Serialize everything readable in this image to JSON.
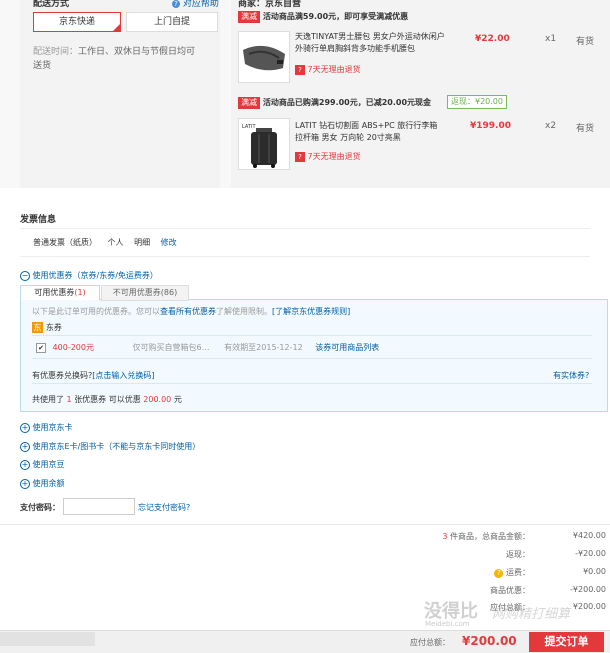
{
  "shipping": {
    "title": "配送方式",
    "help_link": "对应帮助",
    "opt_jd": "京东快递",
    "opt_self": "上门自提",
    "time_label": "配送时间：",
    "time_value": "工作日、双休日与节假日均可送货"
  },
  "store_header": "商家：京东自营",
  "promo1": {
    "tag": "满减",
    "text": "活动商品满59.00元，即可享受满减优惠"
  },
  "product1": {
    "name": "天逸TINYAT男士腰包 男女户外运动休闲户外骑行单肩胸斜背多功能手机腰包",
    "price": "¥22.00",
    "qty": "x1",
    "stock": "有货",
    "returns": "7天无理由退货"
  },
  "promo2": {
    "tag": "满减",
    "text": "活动商品已购满299.00元，已减20.00元现金",
    "saved": "返现：¥20.00"
  },
  "product2": {
    "name": "LATIT 钻石切割面 ABS+PC 旅行行李箱 拉杆箱 男女 万向轮 20寸亮黑",
    "price": "¥199.00",
    "qty": "x2",
    "stock": "有货",
    "returns": "7天无理由退货",
    "brand": "LATIT"
  },
  "invoice": {
    "title": "发票信息",
    "type": "普通发票（纸质）",
    "who": "个人",
    "detail": "明细",
    "edit": "修改"
  },
  "coupon": {
    "toggle": "使用优惠券（京券/东券/免运费券）",
    "tab_usable": "可用优惠券",
    "tab_usable_count": "(1)",
    "tab_unusable": "不可用优惠券(86)",
    "hint_prefix": "以下是此订单可用的优惠券。您可以",
    "hint_link": "查看所有优惠券",
    "hint_mid": "了解使用限制。",
    "hint_rule": "[了解京东优惠券规则]",
    "dong_badge": "东",
    "dong_label": "东券",
    "item_value": "400-200元",
    "item_desc": "仅可购买自营箱包6…",
    "item_expiry": "有效期至2015-12-12",
    "item_link": "该券可用商品列表",
    "redeem_prefix": "有优惠券兑换码?",
    "redeem_link": "[点击输入兑换码]",
    "physical": "有实体券?",
    "summary_a": "共使用了",
    "summary_n": "1",
    "summary_b": "张优惠券  可以优惠",
    "summary_amt": "200.00",
    "summary_c": "元"
  },
  "extras": [
    {
      "label": "使用京东卡"
    },
    {
      "label": "使用京东E卡/图书卡（不能与京东卡同时使用）"
    },
    {
      "label": "使用京豆"
    },
    {
      "label": "使用余额"
    }
  ],
  "pay_pwd": {
    "label": "支付密码：",
    "forgot": "忘记支付密码?"
  },
  "totals": {
    "count": "3",
    "count_label": "件商品，总商品金额：",
    "goods": "¥420.00",
    "cashback_label": "返现：",
    "cashback": "-¥20.00",
    "freight_label": "运费：",
    "freight": "¥0.00",
    "discount_label": "商品优惠：",
    "discount": "-¥200.00",
    "payable_label": "应付总额：",
    "payable": "¥200.00"
  },
  "bottom": {
    "due_label": "应付总额：",
    "due": "¥200.00",
    "submit": "提交订单"
  },
  "watermark": {
    "cn": "没得比",
    "en": "Meidebi.com",
    "right": "网购精打细算"
  }
}
